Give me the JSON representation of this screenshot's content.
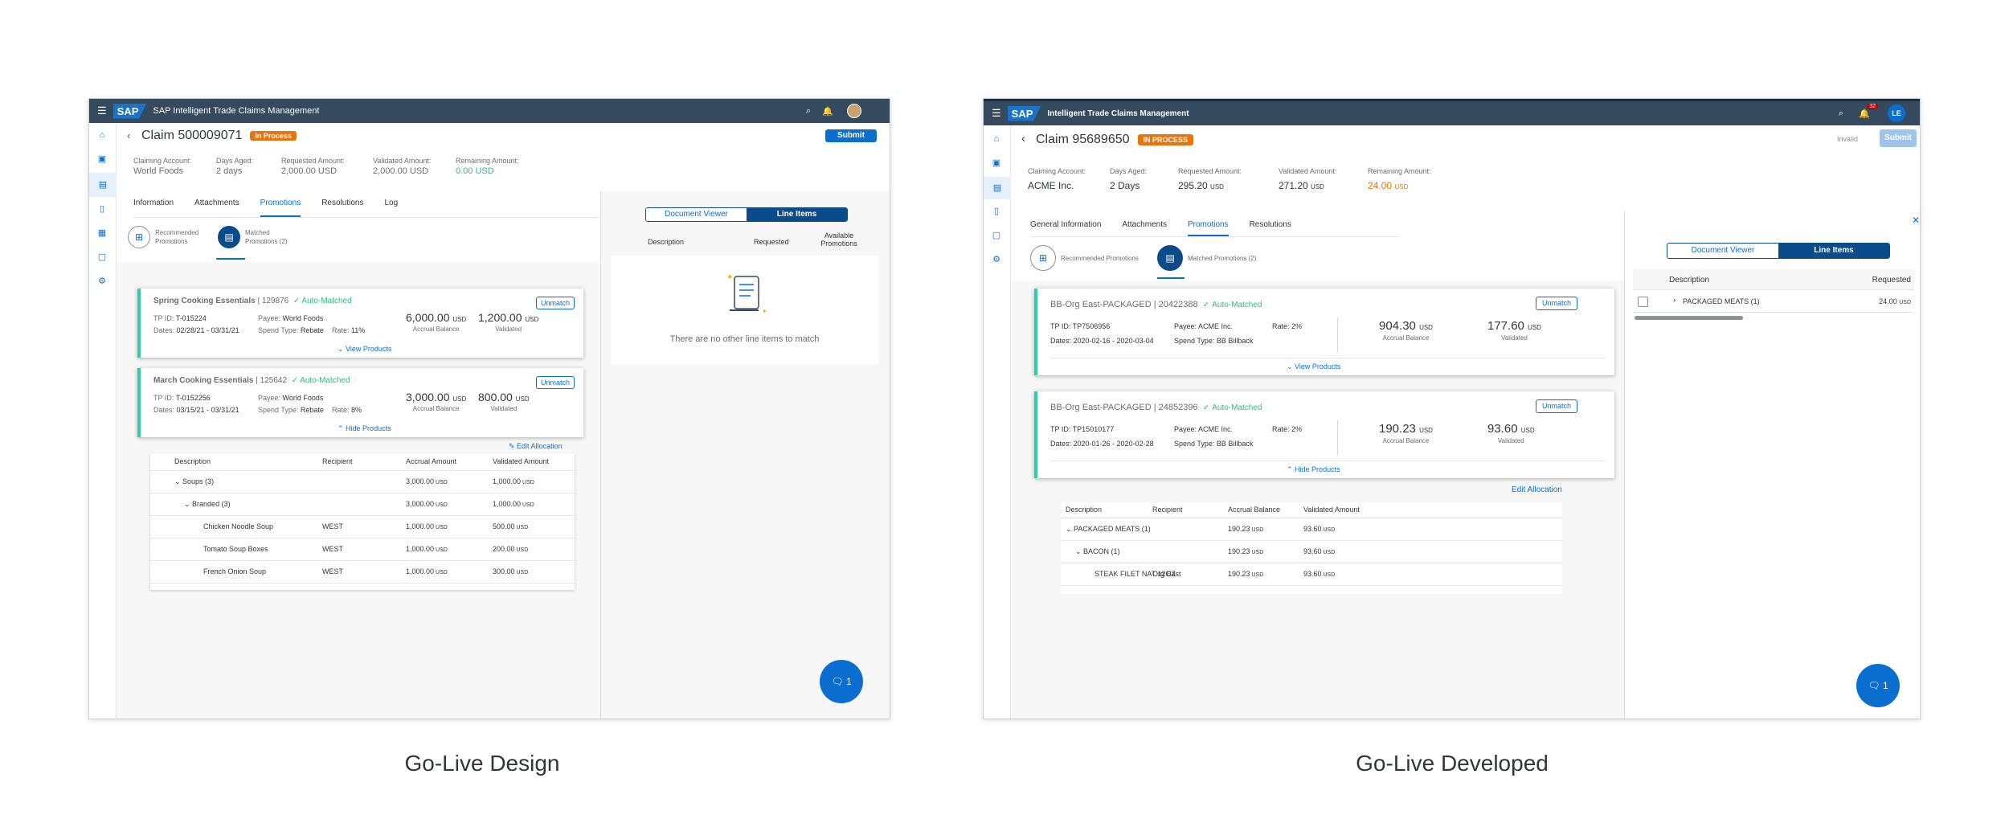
{
  "left": {
    "app_title": "SAP Intelligent Trade Claims Management",
    "logo": "SAP",
    "claim_title": "Claim 500009071",
    "status": "In Process",
    "submit": "Submit",
    "kpis": [
      {
        "label": "Claiming Account:",
        "value": "World Foods"
      },
      {
        "label": "Days Aged:",
        "value": "2 days"
      },
      {
        "label": "Requested Amount:",
        "value": "2,000.00 USD"
      },
      {
        "label": "Validated Amount:",
        "value": "2,000.00 USD"
      },
      {
        "label": "Remaining Amount:",
        "value": "0.00 USD"
      }
    ],
    "tabs": [
      "Information",
      "Attachments",
      "Promotions",
      "Resolutions",
      "Log"
    ],
    "sub_recommended": "Recommended Promotions",
    "sub_matched": "Matched Promotions (2)",
    "cards": [
      {
        "title": "Spring Cooking Essentials",
        "id": "129876",
        "status": "Auto-Matched",
        "tp_label": "TP ID:",
        "tp": "T-015224",
        "dates_label": "Dates:",
        "dates": "02/28/21 - 03/31/21",
        "payee_label": "Payee:",
        "payee": "World Foods",
        "spend_label": "Spend Type:",
        "spend": "Rebate",
        "rate_label": "Rate:",
        "rate": "11%",
        "accrual": "6,000.00",
        "validated": "1,200.00",
        "link": "View Products"
      },
      {
        "title": "March Cooking Essentials",
        "id": "125642",
        "status": "Auto-Matched",
        "tp_label": "TP ID:",
        "tp": "T-0152256",
        "dates_label": "Dates:",
        "dates": "03/15/21 - 03/31/21",
        "payee_label": "Payee:",
        "payee": "World Foods",
        "spend_label": "Spend Type:",
        "spend": "Rebate",
        "rate_label": "Rate:",
        "rate": "8%",
        "accrual": "3,000.00",
        "validated": "800.00",
        "link": "Hide Products"
      }
    ],
    "usd": "USD",
    "accrual_label": "Accrual Balance",
    "validated_label": "Validated",
    "unmatch": "Unmatch",
    "edit_allocation": "Edit Allocation",
    "table_headers": [
      "Description",
      "Recipient",
      "Accrual Amount",
      "Validated Amount"
    ],
    "table_rows": [
      {
        "desc": "Soups (3)",
        "recipient": "",
        "accrual": "3,000.00",
        "validated": "1,000.00",
        "level": 0
      },
      {
        "desc": "Branded (3)",
        "recipient": "",
        "accrual": "3,000.00",
        "validated": "1,000.00",
        "level": 1
      },
      {
        "desc": "Chicken Noodle Soup",
        "recipient": "WEST",
        "accrual": "1,000.00",
        "validated": "500.00",
        "level": 2
      },
      {
        "desc": "Tomato Soup Boxes",
        "recipient": "WEST",
        "accrual": "1,000.00",
        "validated": "200.00",
        "level": 2
      },
      {
        "desc": "French Onion Soup",
        "recipient": "WEST",
        "accrual": "1,000.00",
        "validated": "300.00",
        "level": 2
      }
    ],
    "seg_a": "Document Viewer",
    "seg_b": "Line Items",
    "li_headers": [
      "Description",
      "Requested",
      "Available Promotions"
    ],
    "empty": "There are no other line items to match",
    "fab": "1"
  },
  "right": {
    "app_title": "Intelligent Trade Claims Management",
    "logo": "SAP",
    "notif_count": "32",
    "avatar": "LE",
    "claim_title": "Claim 95689650",
    "status": "IN PROCESS",
    "invalid": "Invalid",
    "submit": "Submit",
    "kpis": [
      {
        "label": "Claiming Account:",
        "value": "ACME Inc.",
        "unit": ""
      },
      {
        "label": "Days Aged:",
        "value": "2 Days",
        "unit": ""
      },
      {
        "label": "Requested Amount:",
        "value": "295.20",
        "unit": "USD"
      },
      {
        "label": "Validated Amount:",
        "value": "271.20",
        "unit": "USD"
      },
      {
        "label": "Remaining Amount:",
        "value": "24.00",
        "unit": "USD"
      }
    ],
    "tabs": [
      "General Information",
      "Attachments",
      "Promotions",
      "Resolutions"
    ],
    "sub_recommended": "Recommended Promotions",
    "sub_matched": "Matched Promotions (2)",
    "cards": [
      {
        "title": "BB-Org East-PACKAGED | 20422388",
        "status": "Auto-Matched",
        "tp": "TP ID: TP7506956",
        "dates": "Dates: 2020-02-16 - 2020-03-04",
        "payee_label": "Payee:",
        "payee": "ACME Inc.",
        "spend_label": "Spend Type:",
        "spend": "BB Billback",
        "rate": "Rate: 2%",
        "accrual": "904.30",
        "validated": "177.60",
        "link": "View Products"
      },
      {
        "title": "BB-Org East-PACKAGED | 24852396",
        "status": "Auto-Matched",
        "tp": "TP ID: TP15010177",
        "dates": "Dates: 2020-01-26 - 2020-02-28",
        "payee_label": "Payee:",
        "payee": "ACME Inc.",
        "spend_label": "Spend Type:",
        "spend": "BB Billback",
        "rate": "Rate: 2%",
        "accrual": "190.23",
        "validated": "93.60",
        "link": "Hide Products"
      }
    ],
    "usd": "USD",
    "accrual_label": "Accrual Balance",
    "validated_label": "Validated",
    "unmatch": "Unmatch",
    "edit_allocation": "Edit Allocation",
    "table_headers": [
      "Description",
      "Recipient",
      "Accrual Balance",
      "Validated Amount"
    ],
    "table_rows": [
      {
        "desc": "PACKAGED MEATS (1)",
        "recipient": "",
        "accrual": "190.23",
        "validated": "93.60",
        "level": 0
      },
      {
        "desc": "BACON (1)",
        "recipient": "",
        "accrual": "190.23",
        "validated": "93.60",
        "level": 1
      },
      {
        "desc": "STEAK FILET NAT 12OZ",
        "recipient": "Org East",
        "accrual": "190.23",
        "validated": "93.60",
        "level": 2
      }
    ],
    "seg_a": "Document Viewer",
    "seg_b": "Line Items",
    "li_headers": [
      "Description",
      "Requested"
    ],
    "li_row": {
      "desc": "PACKAGED MEATS (1)",
      "requested": "24.00",
      "unit": "USD"
    },
    "fab": "1"
  },
  "captions": {
    "left": "Go-Live Design",
    "right": "Go-Live Developed"
  },
  "colors": {
    "shell": "#354a5f",
    "brand": "#0a6ed1",
    "status": "#e9730c",
    "matched": "#2dd1a4",
    "remaining_left": "#2ebd84",
    "remaining_right": "#e9730c"
  }
}
